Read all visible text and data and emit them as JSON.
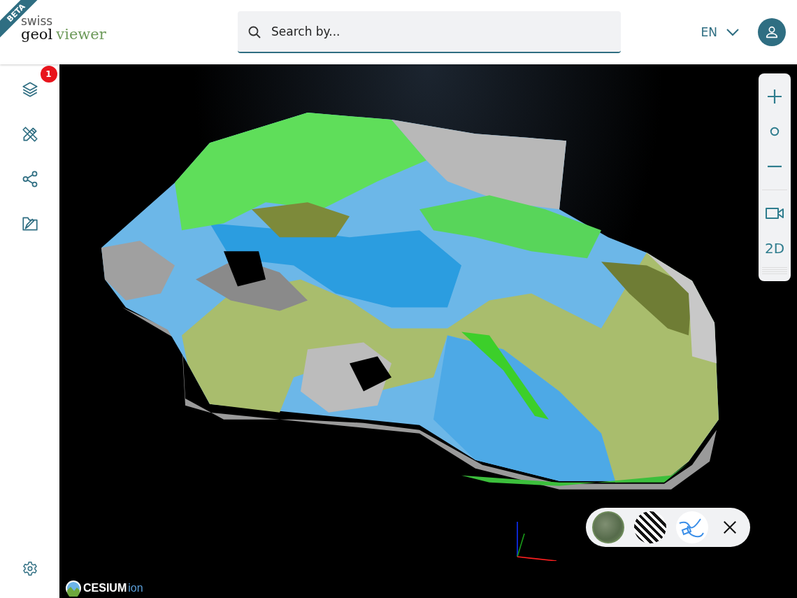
{
  "header": {
    "beta_ribbon": "BETA",
    "logo": {
      "top": "swiss",
      "bottom": "geol",
      "suffix": "viewer"
    },
    "search": {
      "placeholder": "Search by..."
    },
    "language": "EN"
  },
  "sidebar": {
    "items": [
      {
        "kind": "layers",
        "badge": "1"
      },
      {
        "kind": "tools"
      },
      {
        "kind": "share"
      },
      {
        "kind": "projects"
      }
    ],
    "footer": [
      {
        "kind": "settings"
      }
    ]
  },
  "nav_controls": [
    {
      "kind": "zoom-in"
    },
    {
      "kind": "reset"
    },
    {
      "kind": "zoom-out"
    },
    {
      "kind": "divider"
    },
    {
      "kind": "camera"
    },
    {
      "kind": "text",
      "label": "2D"
    }
  ],
  "basemaps": [
    {
      "kind": "aerial"
    },
    {
      "kind": "street"
    },
    {
      "kind": "hydro"
    }
  ],
  "attribution": {
    "brand": "CESIUM",
    "suffix": "ion"
  }
}
